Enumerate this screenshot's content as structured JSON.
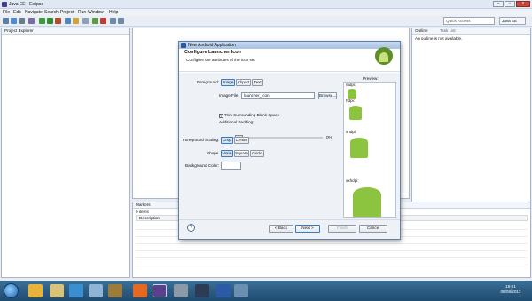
{
  "window": {
    "title": "Java EE - Eclipse"
  },
  "menu": [
    "File",
    "Edit",
    "Navigate",
    "Search",
    "Project",
    "Run",
    "Window",
    "Help"
  ],
  "toolbar": {
    "quick_access_placeholder": "Quick Access",
    "perspective_label": "Java EE"
  },
  "project_explorer": {
    "title": "Project Explorer",
    "tab_marker": "☒"
  },
  "outline": {
    "title": "Outline",
    "task_list": "Task List",
    "message": "An outline is not available."
  },
  "markers": {
    "title": "Markers",
    "count": "0 items",
    "column": "Description"
  },
  "dialog": {
    "title": "New Android Application",
    "heading": "Configure Launcher Icon",
    "subheading": "Configure the attributes of the icon set",
    "foreground_label": "Foreground:",
    "foreground_options": [
      "Image",
      "Clipart",
      "Text"
    ],
    "image_file_label": "Image File:",
    "image_file_value": "launcher_icon",
    "browse_label": "Browse...",
    "trim_label": "Trim Surrounding Blank Space",
    "trim_checked": true,
    "padding_label": "Additional Padding:",
    "padding_value": "0%",
    "scaling_label": "Foreground Scaling:",
    "scaling_options": [
      "Crop",
      "Center"
    ],
    "shape_label": "Shape",
    "shape_options": [
      "None",
      "Square",
      "Circle"
    ],
    "bg_color_label": "Background Color:",
    "preview_label": "Preview:",
    "preview_densities": [
      "mdpi:",
      "hdpi:",
      "xhdpi:",
      "xxhdpi:"
    ],
    "back_label": "< Back",
    "next_label": "Next >",
    "finish_label": "Finish",
    "cancel_label": "Cancel",
    "help_label": "?"
  },
  "taskbar": {
    "time": "19:01",
    "date": "08/08/2013"
  }
}
